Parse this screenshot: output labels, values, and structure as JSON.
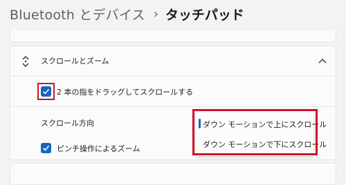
{
  "breadcrumb": {
    "parent": "Bluetooth とデバイス",
    "separator": "›",
    "current": "タッチパッド"
  },
  "section": {
    "title": "スクロールとズーム",
    "icon": "scroll-icon",
    "collapse_icon": "chevron-up-icon"
  },
  "rows": {
    "two_finger_scroll": {
      "label": "2 本の指をドラッグしてスクロールする",
      "checked": true
    },
    "scroll_direction": {
      "label": "スクロール方向"
    },
    "pinch_zoom": {
      "label": "ピンチ操作によるズーム",
      "checked": true
    }
  },
  "scroll_direction_dropdown": {
    "options": [
      "ダウン モーションで上にスクロール",
      "ダウン モーションで下にスクロール"
    ],
    "selected": "ダウン モーションで上にスクロール"
  },
  "colors": {
    "accent": "#1765c0",
    "highlight": "#d0102b",
    "background": "#f3f3f3",
    "card": "#fbfbfb"
  }
}
